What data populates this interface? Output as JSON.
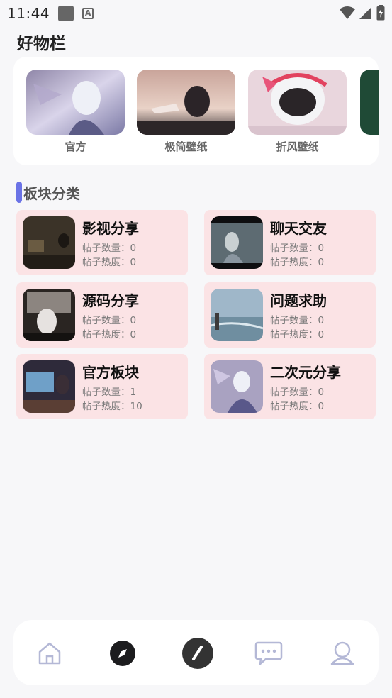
{
  "status_bar": {
    "time": "11:44",
    "icons": [
      "app-square-icon",
      "font-a-icon",
      "wifi-icon",
      "cellular-icon",
      "battery-charging-icon"
    ]
  },
  "page": {
    "title": "好物栏"
  },
  "carousel": {
    "items": [
      {
        "label": "官方"
      },
      {
        "label": "极简壁纸"
      },
      {
        "label": "折风壁纸"
      },
      {
        "label": ""
      }
    ]
  },
  "category": {
    "title": "板块分类"
  },
  "boards": [
    {
      "name": "影视分享",
      "post_count": "帖子数量：0",
      "heat": "帖子热度：0"
    },
    {
      "name": "聊天交友",
      "post_count": "帖子数量：0",
      "heat": "帖子热度：0"
    },
    {
      "name": "源码分享",
      "post_count": "帖子数量：0",
      "heat": "帖子热度：0"
    },
    {
      "name": "问题求助",
      "post_count": "帖子数量：0",
      "heat": "帖子热度：0"
    },
    {
      "name": "官方板块",
      "post_count": "帖子数量：1",
      "heat": "帖子热度：10"
    },
    {
      "name": "二次元分享",
      "post_count": "帖子数量：0",
      "heat": "帖子热度：0"
    }
  ],
  "bottom_nav": {
    "items": [
      "home-icon",
      "compass-icon",
      "pen-icon",
      "chat-icon",
      "profile-icon"
    ]
  },
  "colors": {
    "accent": "#6b73e6",
    "board_bg": "#fbe3e5",
    "page_bg": "#f7f7f9"
  }
}
